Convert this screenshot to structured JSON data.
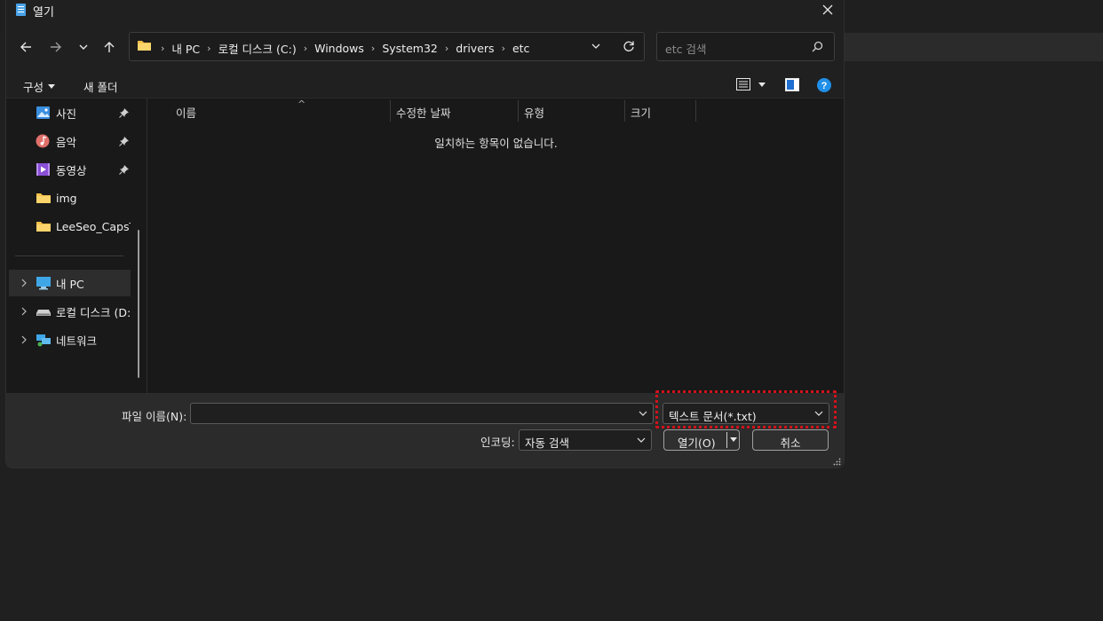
{
  "window": {
    "title": "열기"
  },
  "nav": {
    "breadcrumbs": [
      "내 PC",
      "로컬 디스크 (C:)",
      "Windows",
      "System32",
      "drivers",
      "etc"
    ],
    "search_placeholder": "etc 검색"
  },
  "toolbar": {
    "organize": "구성",
    "new_folder": "새 폴더"
  },
  "sidebar": {
    "pinned": [
      {
        "label": "사진",
        "icon": "pictures-icon"
      },
      {
        "label": "음악",
        "icon": "music-icon"
      },
      {
        "label": "동영상",
        "icon": "videos-icon"
      },
      {
        "label": "img",
        "icon": "folder-icon"
      },
      {
        "label": "LeeSeo_CapsTra",
        "icon": "folder-icon"
      }
    ],
    "tree": [
      {
        "label": "내 PC",
        "icon": "pc-icon",
        "selected": true
      },
      {
        "label": "로컬 디스크 (D:",
        "icon": "drive-icon"
      },
      {
        "label": "네트워크",
        "icon": "network-icon"
      }
    ]
  },
  "columns": [
    "이름",
    "수정한 날짜",
    "유형",
    "크기"
  ],
  "empty_message": "일치하는 항목이 없습니다.",
  "bottom": {
    "filename_label": "파일 이름(N):",
    "filename_value": "",
    "filetype_value": "텍스트 문서(*.txt)",
    "encoding_label": "인코딩:",
    "encoding_value": "자동 검색",
    "open_label": "열기(O)",
    "cancel_label": "취소"
  },
  "colors": {
    "highlight": "#d1131a",
    "accent_blue": "#1f8fe8"
  }
}
